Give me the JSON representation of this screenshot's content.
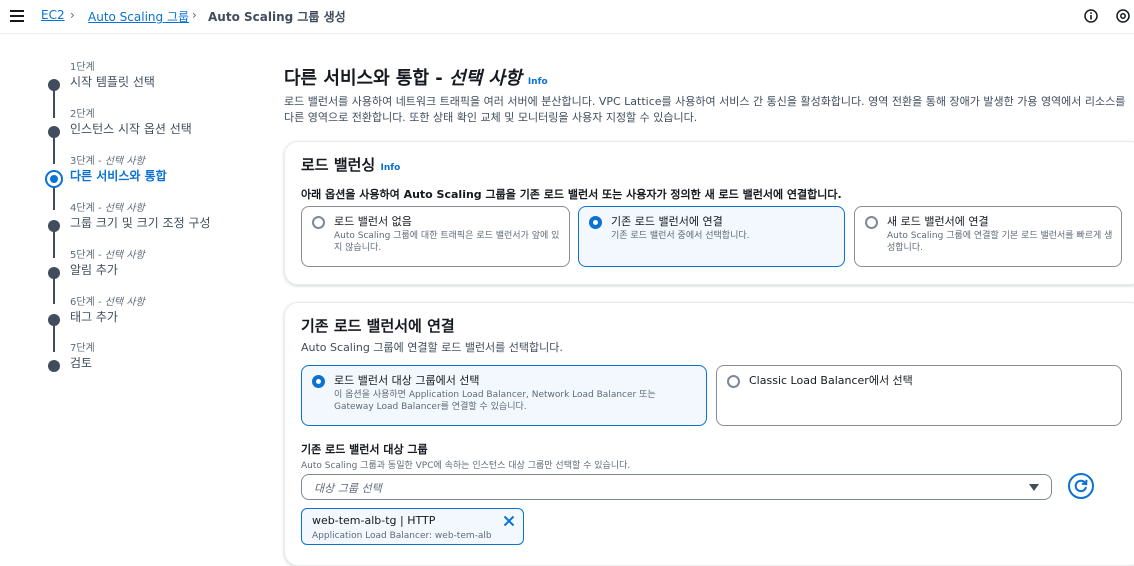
{
  "breadcrumb": {
    "items": [
      "EC2",
      "Auto Scaling 그룹"
    ],
    "current": "Auto Scaling 그룹 생성"
  },
  "steps": [
    {
      "num": "1단계",
      "optional": "",
      "label": "시작 템플릿 선택"
    },
    {
      "num": "2단계",
      "optional": "",
      "label": "인스턴스 시작 옵션 선택"
    },
    {
      "num": "3단계 - ",
      "optional": "선택 사항",
      "label": "다른 서비스와 통합"
    },
    {
      "num": "4단계 - ",
      "optional": "선택 사항",
      "label": "그룹 크기 및 크기 조정 구성"
    },
    {
      "num": "5단계 - ",
      "optional": "선택 사항",
      "label": "알림 추가"
    },
    {
      "num": "6단계 - ",
      "optional": "선택 사항",
      "label": "태그 추가"
    },
    {
      "num": "7단계",
      "optional": "",
      "label": "검토"
    }
  ],
  "active_step": 3,
  "page": {
    "title": "다른 서비스와 통합 - ",
    "title_optional": "선택 사항",
    "info": "Info",
    "description": "로드 밸런서를 사용하여 네트워크 트래픽을 여러 서버에 분산합니다. VPC Lattice를 사용하여 서비스 간 통신을 활성화합니다. 영역 전환을 통해 장애가 발생한 가용 영역에서 리소스를 다른 영역으로 전환합니다. 또한 상태 확인 교체 및 모니터링을 사용자 지정할 수 있습니다."
  },
  "load_balancing": {
    "title": "로드 밸런싱",
    "info": "Info",
    "subtitle": "아래 옵션을 사용하여 Auto Scaling 그룹을 기존 로드 밸런서 또는 사용자가 정의한 새 로드 밸런서에 연결합니다.",
    "options": [
      {
        "label": "로드 밸런서 없음",
        "desc": "Auto Scaling 그룹에 대한 트래픽은 로드 밸런서가 앞에 있지 않습니다.",
        "selected": false
      },
      {
        "label": "기존 로드 밸런서에 연결",
        "desc": "기존 로드 밸런서 중에서 선택합니다.",
        "selected": true
      },
      {
        "label": "새 로드 밸런서에 연결",
        "desc": "Auto Scaling 그룹에 연결할 기본 로드 밸런서를 빠르게 생성합니다.",
        "selected": false
      }
    ]
  },
  "attach_existing": {
    "title": "기존 로드 밸런서에 연결",
    "subtitle": "Auto Scaling 그룹에 연결할 로드 밸런서를 선택합니다.",
    "options": [
      {
        "label": "로드 밸런서 대상 그룹에서 선택",
        "desc": "이 옵션을 사용하면 Application Load Balancer, Network Load Balancer 또는 Gateway Load Balancer를 연결할 수 있습니다.",
        "selected": true
      },
      {
        "label": "Classic Load Balancer에서 선택",
        "desc": "",
        "selected": false
      }
    ],
    "target_group_label": "기존 로드 밸런서 대상 그룹",
    "target_group_desc": "Auto Scaling 그룹과 동일한 VPC에 속하는 인스턴스 대상 그룹만 선택할 수 있습니다.",
    "select_placeholder": "대상 그룹 선택",
    "token": {
      "name": "web-tem-alb-tg | HTTP",
      "detail": "Application Load Balancer: web-tem-alb"
    }
  },
  "colors": {
    "accent": "#0972d3",
    "selected_bg": "#f2f8fd",
    "text": "#16191f"
  }
}
